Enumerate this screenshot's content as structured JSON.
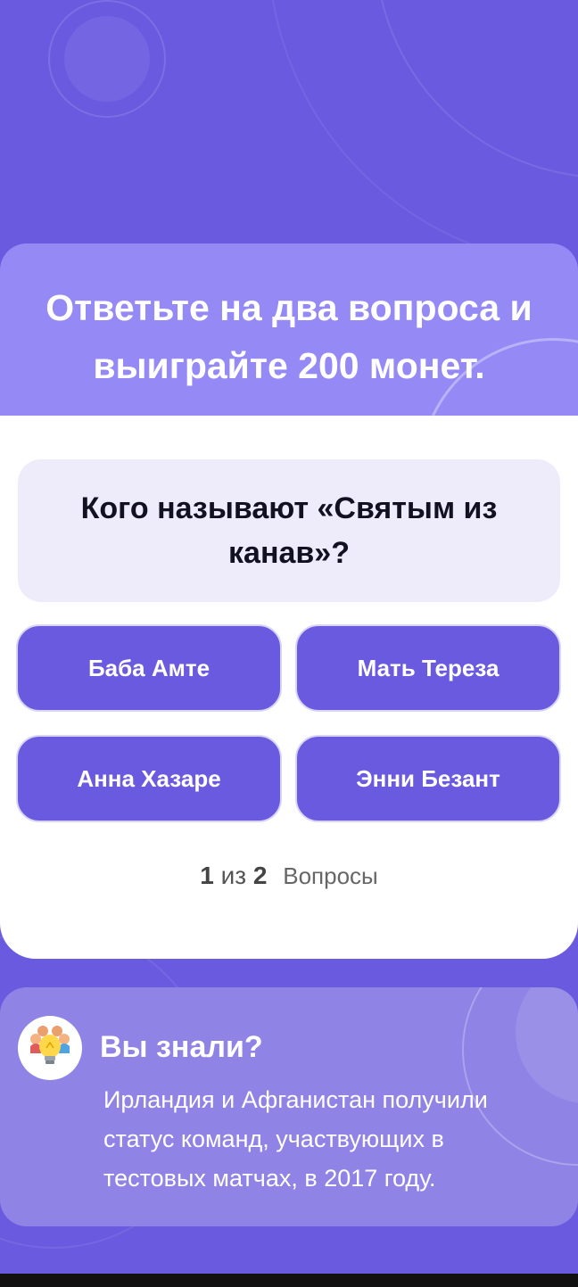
{
  "hero": {
    "title": "Ответьте на два вопроса и выиграйте 200 монет."
  },
  "quiz": {
    "question": "Кого называют «Святым из канав»?",
    "answers": [
      "Баба Амте",
      "Мать Тереза",
      "Анна Хазаре",
      "Энни Безант"
    ],
    "progress": {
      "current": "1",
      "separator": "из",
      "total": "2",
      "label": "Вопросы"
    }
  },
  "fact": {
    "icon": "lightbulb-kids-icon",
    "title": "Вы знали?",
    "text": "Ирландия и Афганистан получили статус команд, участвующих в тестовых матчах, в 2017 году."
  },
  "colors": {
    "background": "#6a5ae0",
    "hero": "#9489f5",
    "question_box": "#eeecfb",
    "answer_button": "#6a5ae0",
    "fact_card": "#8f84e6"
  }
}
